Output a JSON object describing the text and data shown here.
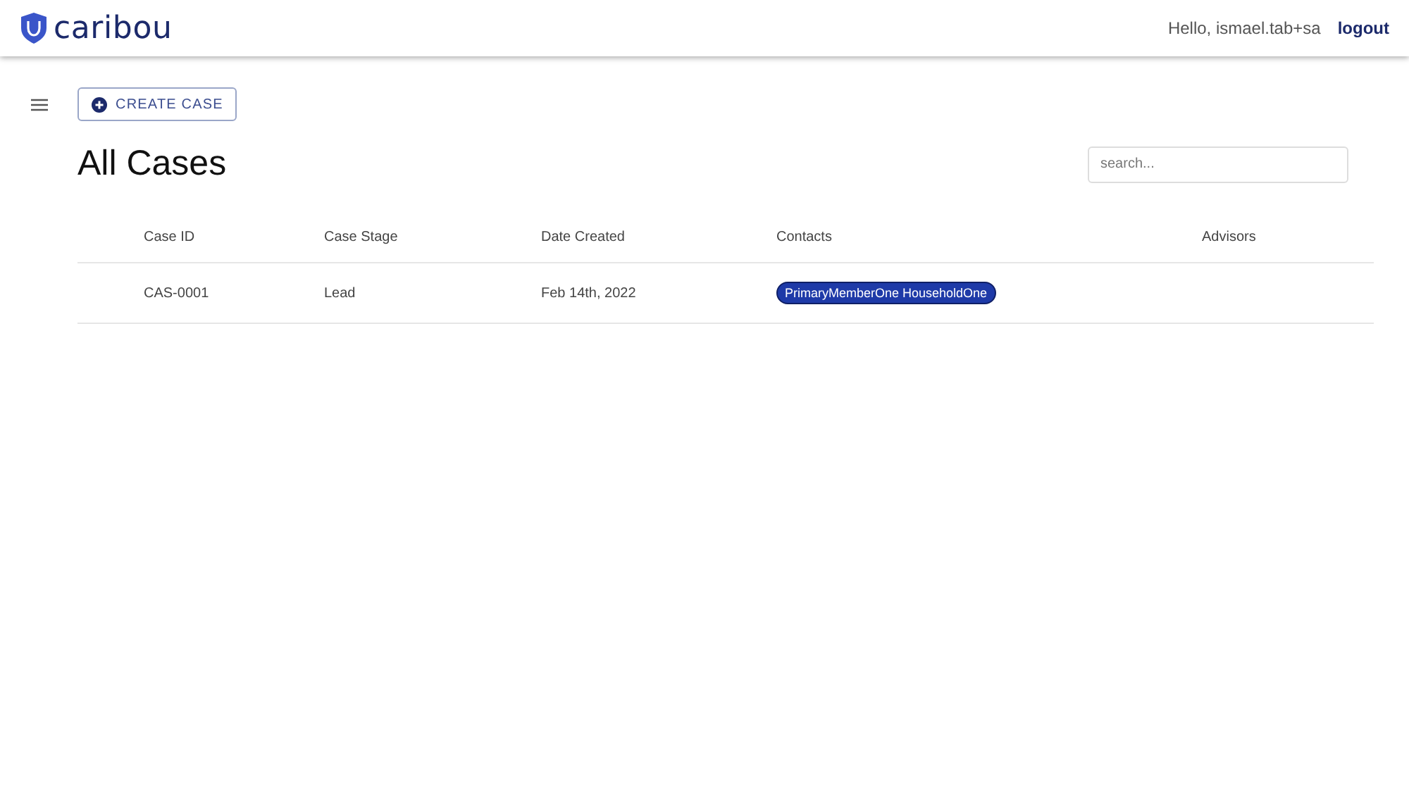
{
  "header": {
    "logo": "caribou",
    "greeting": "Hello, ismael.tab+sa",
    "logout": "logout"
  },
  "create_button": "CREATE CASE",
  "title": "All Cases",
  "search": {
    "placeholder": "search..."
  },
  "table": {
    "columns": [
      "Case ID",
      "Case Stage",
      "Date Created",
      "Contacts",
      "Advisors"
    ],
    "rows": [
      {
        "case_id": "CAS-0001",
        "stage": "Lead",
        "date": "Feb 14th, 2022",
        "contacts": [
          "PrimaryMemberOne HouseholdOne"
        ]
      }
    ]
  }
}
